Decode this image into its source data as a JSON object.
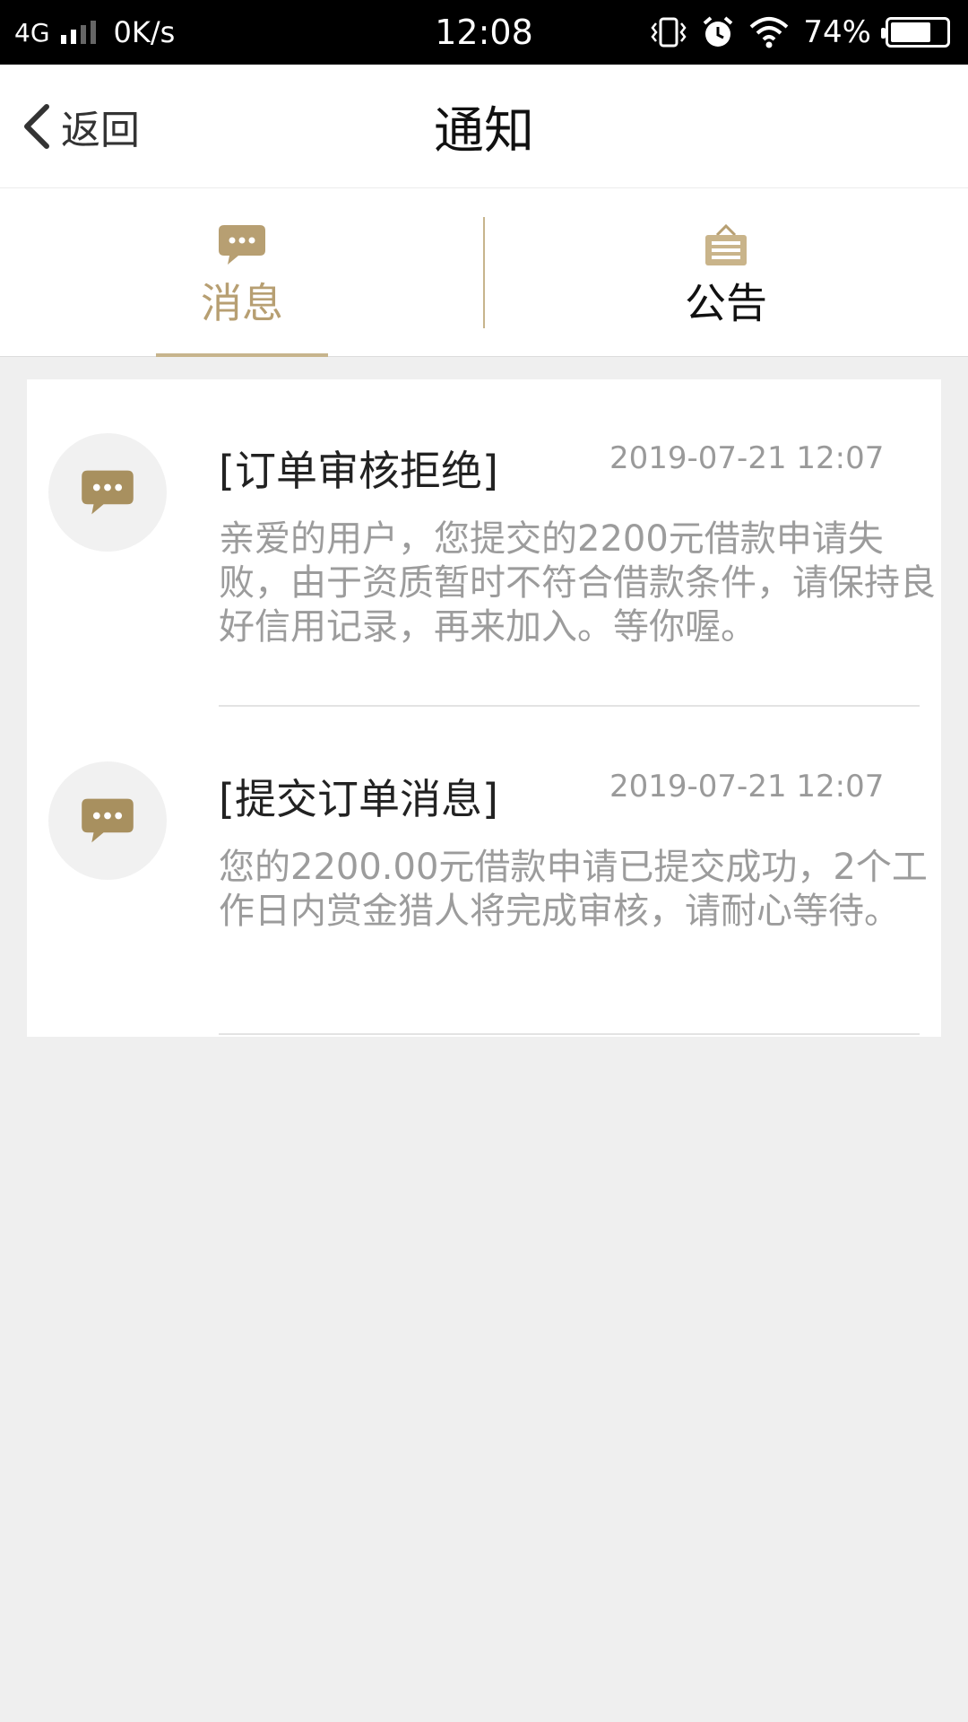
{
  "status_bar": {
    "network": "4G",
    "speed": "0K/s",
    "time": "12:08",
    "battery_pct": "74%",
    "battery_level": 0.74
  },
  "header": {
    "back_label": "返回",
    "title": "通知"
  },
  "tabs": [
    {
      "label": "消息",
      "icon": "chat-bubble-icon",
      "active": true
    },
    {
      "label": "公告",
      "icon": "notice-board-icon",
      "active": false
    }
  ],
  "colors": {
    "accent": "#b79f72",
    "status_bar_bg": "#000000",
    "page_bg": "#efefef"
  },
  "messages": [
    {
      "title": "[订单审核拒绝]",
      "time": "2019-07-21 12:07",
      "body": "亲爱的用户，您提交的2200元借款申请失败，由于资质暂时不符合借款条件，请保持良好信用记录，再来加入。等你喔。"
    },
    {
      "title": "[提交订单消息]",
      "time": "2019-07-21 12:07",
      "body": "您的2200.00元借款申请已提交成功，2个工作日内赏金猎人将完成审核，请耐心等待。"
    }
  ]
}
